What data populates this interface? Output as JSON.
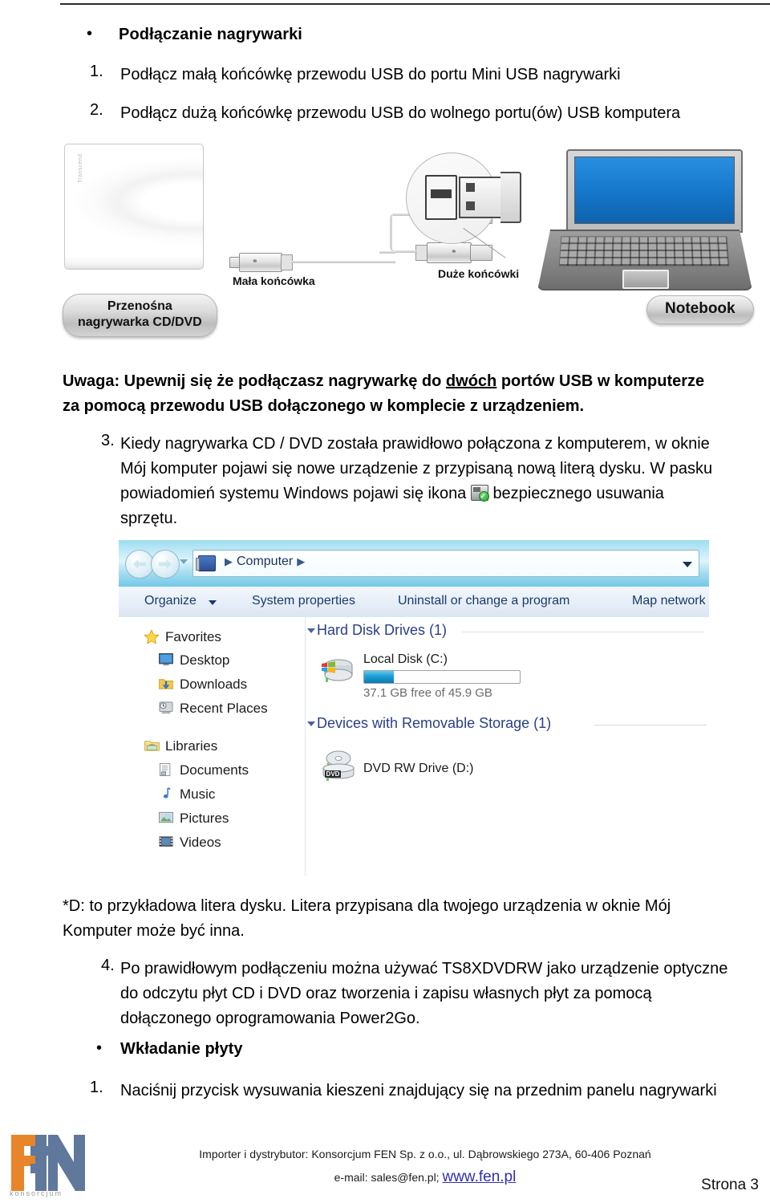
{
  "document": {
    "section1": {
      "heading": "Podłączanie nagrywarki",
      "steps": [
        {
          "num": "1.",
          "text": "Podłącz małą końcówkę przewodu USB do portu Mini USB nagrywarki"
        },
        {
          "num": "2.",
          "text": "Podłącz dużą końcówkę przewodu USB do wolnego portu(ów) USB komputera"
        }
      ]
    },
    "illustration": {
      "drive_brand": "Transcend",
      "drive_badge_line1": "Przenośna",
      "drive_badge_line2": "nagrywarka CD/DVD",
      "small_connector_caption": "Mała końcówka",
      "large_connector_caption": "Duże końcówki",
      "notebook_badge": "Notebook",
      "usb_logo_glyph": "⚯"
    },
    "note": {
      "line1_pre": "Uwaga: Upewnij się że podłączasz nagrywarkę do ",
      "line1_underlined": "dwóch",
      "line1_post": " portów USB w komputerze",
      "line2": "za pomocą przewodu USB dołączonego w komplecie z urządzeniem."
    },
    "step3": {
      "num": "3.",
      "line1": "Kiedy nagrywarka CD / DVD została prawidłowo połączona z komputerem, w oknie",
      "line2": "Mój komputer pojawi się nowe urządzenie z przypisaną nową literą dysku. W pasku",
      "line3_pre": "powiadomień systemu Windows pojawi się ikona",
      "line3_post": "bezpiecznego usuwania",
      "line4": "sprzętu.",
      "icon_name": "safely-remove-hardware-icon"
    },
    "footnote": {
      "line1": "*D: to przykładowa litera dysku. Litera przypisana dla twojego urządzenia w oknie Mój",
      "line2": "Komputer może być inna."
    },
    "step4": {
      "num": "4.",
      "line1": "Po prawidłowym podłączeniu można używać TS8XDVDRW jako urządzenie optyczne",
      "line2": "do odczytu płyt CD i DVD oraz tworzenia i zapisu własnych płyt za pomocą",
      "line3": "dołączonego oprogramowania Power2Go."
    },
    "section2": {
      "heading": "Wkładanie płyty",
      "steps": [
        {
          "num": "1.",
          "text": "Naciśnij przycisk wysuwania kieszeni znajdujący się na przednim panelu nagrywarki"
        }
      ]
    }
  },
  "explorer": {
    "address": {
      "icon": "computer-icon",
      "sep1": "▶",
      "crumb": "Computer",
      "sep2": "▶"
    },
    "toolbar": [
      {
        "label": "Organize",
        "caret": true
      },
      {
        "label": "System properties",
        "caret": false
      },
      {
        "label": "Uninstall or change a program",
        "caret": false
      },
      {
        "label": "Map network dr",
        "caret": false
      }
    ],
    "sidebar": [
      {
        "label": "Favorites",
        "icon": "star-icon",
        "level": 0
      },
      {
        "label": "Desktop",
        "icon": "desktop-icon",
        "level": 1
      },
      {
        "label": "Downloads",
        "icon": "downloads-folder-icon",
        "level": 1
      },
      {
        "label": "Recent Places",
        "icon": "recent-places-icon",
        "level": 1
      },
      {
        "label": "Libraries",
        "icon": "libraries-icon",
        "level": 0
      },
      {
        "label": "Documents",
        "icon": "documents-icon",
        "level": 1
      },
      {
        "label": "Music",
        "icon": "music-icon",
        "level": 1
      },
      {
        "label": "Pictures",
        "icon": "pictures-icon",
        "level": 1
      },
      {
        "label": "Videos",
        "icon": "videos-icon",
        "level": 1
      }
    ],
    "groups": [
      {
        "title": "Hard Disk Drives (1)"
      },
      {
        "title": "Devices with Removable Storage (1)"
      }
    ],
    "local_disk": {
      "name": "Local Disk (C:)",
      "free_text": "37.1 GB free of 45.9 GB",
      "used_percent": 19,
      "bar_color": "#1d9fd4"
    },
    "dvd_drive": {
      "name": "DVD RW Drive (D:)",
      "badge": "DVD"
    }
  },
  "footer": {
    "logo_text": "konsorcjum",
    "logo_letters": "FEN",
    "line1": "Importer i dystrybutor: Konsorcjum FEN Sp. z o.o., ul. Dąbrowskiego 273A, 60-406 Poznań",
    "line2_pre": "e-mail: sales@fen.pl; ",
    "line2_link": "www.fen.pl",
    "page_label": "Strona 3"
  },
  "colors": {
    "accent_blue": "#1d9fd4",
    "screen_blue": "#1576c9",
    "link_blue": "#2f2fb0",
    "logo_orange": "#e8842a",
    "logo_slate": "#5f789c",
    "group_heading": "#2a3f88"
  }
}
